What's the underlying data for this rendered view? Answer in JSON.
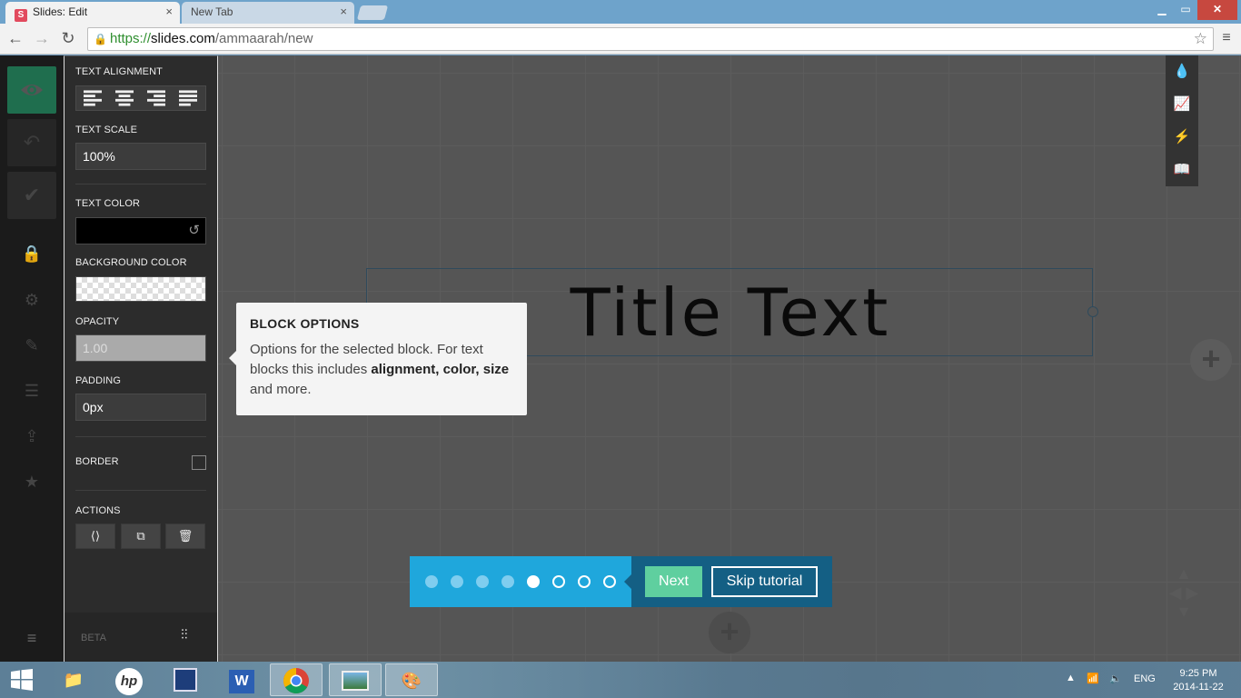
{
  "browser": {
    "tabs": [
      {
        "title": "Slides: Edit",
        "favicon": "S",
        "active": true
      },
      {
        "title": "New Tab",
        "active": false
      }
    ],
    "tab_close_glyph": "×",
    "url": {
      "scheme": "https://",
      "host": "slides.com",
      "path": "/ammaarah/new"
    },
    "window_controls": {
      "minimize": "▁",
      "maximize": "▭",
      "close": "✕"
    }
  },
  "left_rail": {
    "items": [
      "preview-icon",
      "undo-icon",
      "save-check-icon",
      "lock-icon",
      "settings-icon",
      "style-brush-icon",
      "layers-icon",
      "import-icon",
      "star-icon",
      "menu-icon"
    ]
  },
  "options_panel": {
    "text_alignment_label": "TEXT ALIGNMENT",
    "text_scale_label": "TEXT SCALE",
    "text_scale_value": "100%",
    "text_color_label": "TEXT COLOR",
    "text_color": "#000000",
    "background_color_label": "BACKGROUND COLOR",
    "opacity_label": "OPACITY",
    "opacity_value": "1.00",
    "padding_label": "PADDING",
    "padding_value": "0px",
    "border_label": "BORDER",
    "actions_label": "ACTIONS",
    "beta_label": "BETA"
  },
  "slide": {
    "title_text": "Title Text"
  },
  "tooltip": {
    "title": "BLOCK OPTIONS",
    "body_pre": "Options for the selected block. For text blocks this includes ",
    "body_bold1": "alignment, color, size",
    "body_post": " and more."
  },
  "tutorial": {
    "total_steps": 8,
    "current_step": 5,
    "next_label": "Next",
    "skip_label": "Skip tutorial"
  },
  "taskbar": {
    "language": "ENG",
    "time": "9:25 PM",
    "date": "2014-11-22",
    "pinned": [
      "file-explorer-icon",
      "hp-icon",
      "app-icon",
      "word-icon",
      "chrome-icon",
      "photo-viewer-icon",
      "paint-icon"
    ]
  },
  "colors": {
    "accent_green": "#5fcf9f",
    "tutorial_blue": "#1fa7dc",
    "tutorial_dark": "#145f84"
  }
}
